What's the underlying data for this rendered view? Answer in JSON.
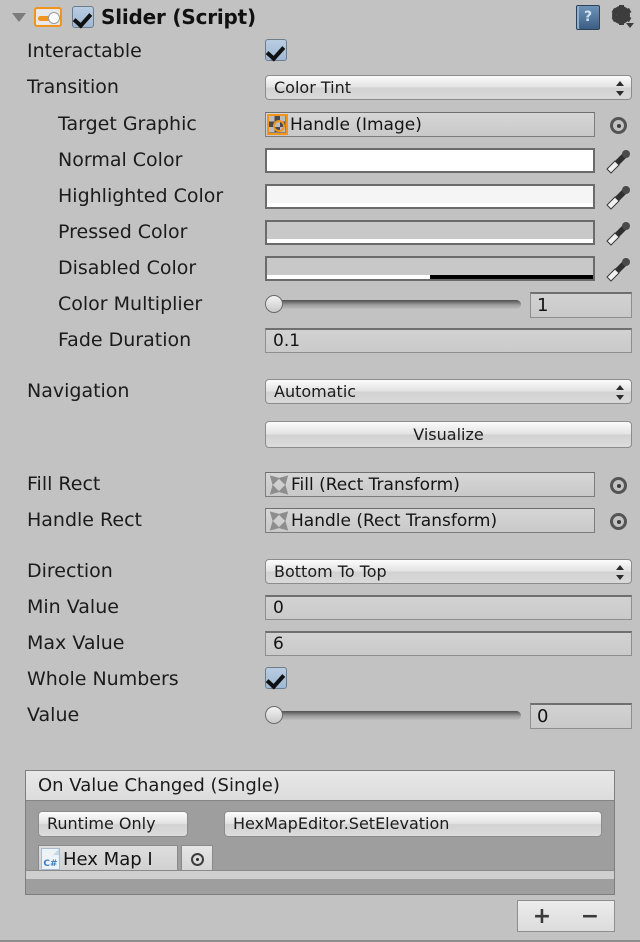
{
  "header": {
    "title": "Slider (Script)",
    "enabled": true,
    "foldout_open": true,
    "component_icon": "slider-icon",
    "help_icon": "help-book-icon",
    "help_glyph": "?",
    "gear_icon": "gear-settings-icon"
  },
  "fields": {
    "interactable": {
      "label": "Interactable",
      "checked": true
    },
    "transition": {
      "label": "Transition",
      "value": "Color Tint"
    },
    "target_graphic": {
      "label": "Target Graphic",
      "value": "Handle (Image)",
      "icon": "image-component-icon"
    },
    "normal_color": {
      "label": "Normal Color",
      "color": "#ffffff",
      "alpha_pct": 100
    },
    "highlighted_color": {
      "label": "Highlighted Color",
      "color": "#f5f5f5",
      "alpha_pct": 100
    },
    "pressed_color": {
      "label": "Pressed Color",
      "color": "#c8c8c8",
      "alpha_pct": 100
    },
    "disabled_color": {
      "label": "Disabled Color",
      "color": "#c8c8c8",
      "alpha_pct": 50
    },
    "color_multiplier": {
      "label": "Color Multiplier",
      "value": "1",
      "slider_pct": 0
    },
    "fade_duration": {
      "label": "Fade Duration",
      "value": "0.1"
    },
    "navigation": {
      "label": "Navigation",
      "value": "Automatic"
    },
    "visualize": {
      "label": "Visualize"
    },
    "fill_rect": {
      "label": "Fill Rect",
      "value": "Fill (Rect Transform)",
      "icon": "rect-transform-icon"
    },
    "handle_rect": {
      "label": "Handle Rect",
      "value": "Handle (Rect Transform)",
      "icon": "rect-transform-icon"
    },
    "direction": {
      "label": "Direction",
      "value": "Bottom To Top"
    },
    "min_value": {
      "label": "Min Value",
      "value": "0"
    },
    "max_value": {
      "label": "Max Value",
      "value": "6"
    },
    "whole_numbers": {
      "label": "Whole Numbers",
      "checked": true
    },
    "value": {
      "label": "Value",
      "value": "0",
      "slider_pct": 0
    }
  },
  "event": {
    "title": "On Value Changed (Single)",
    "call_state": "Runtime Only",
    "method": "HexMapEditor.SetElevation",
    "target_object": "Hex Map I",
    "target_icon": "csharp-script-icon",
    "add_label": "+",
    "remove_label": "−"
  }
}
